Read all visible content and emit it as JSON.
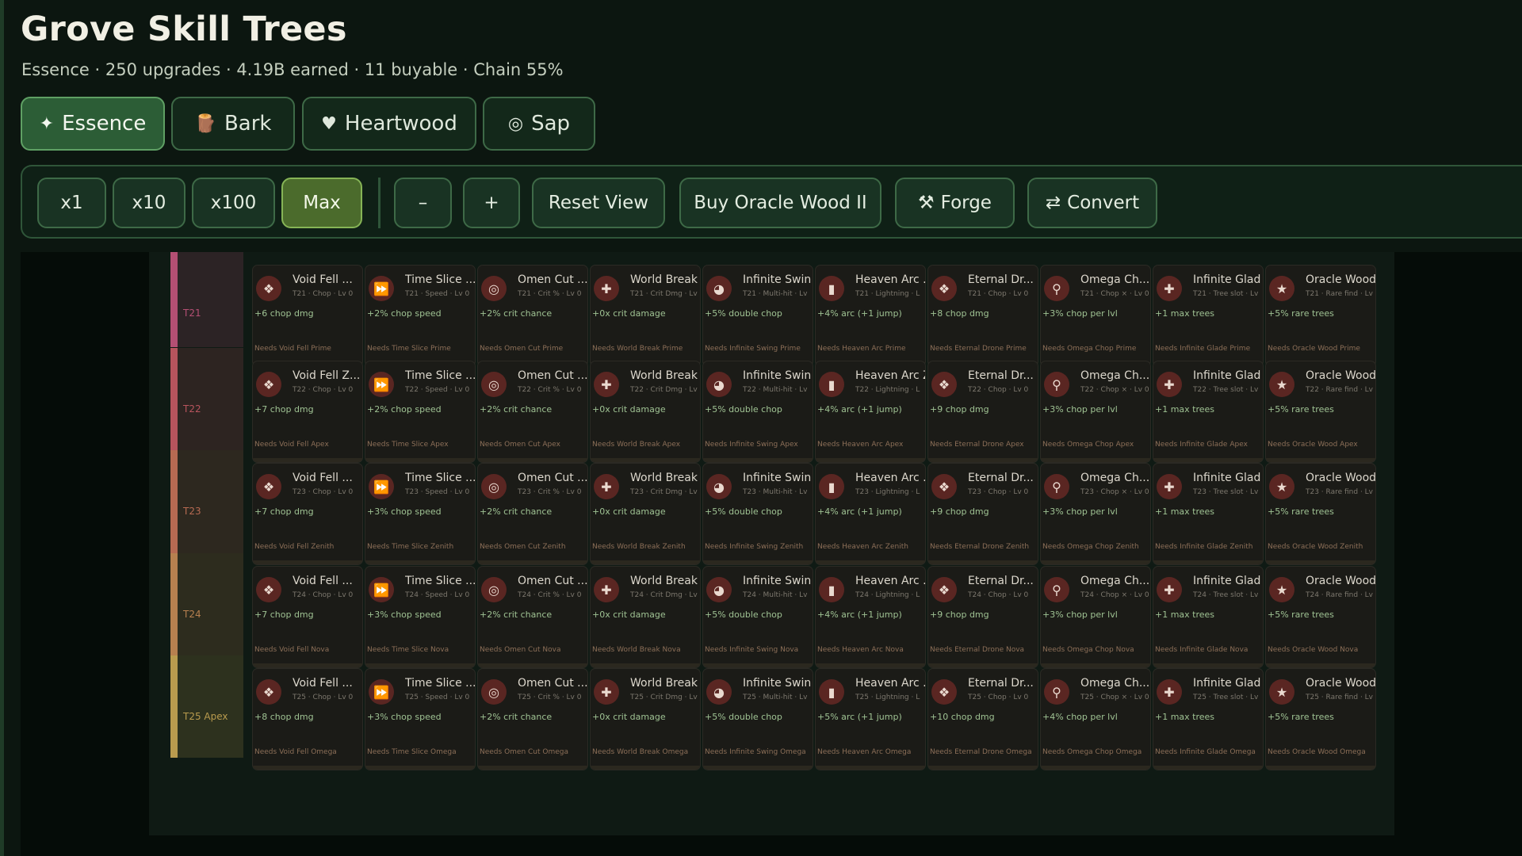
{
  "title": "Grove Skill Trees",
  "subtitle": "Essence · 250 upgrades · 4.19B earned · 11 buyable · Chain 55%",
  "tabs": [
    {
      "label": "Essence",
      "icon": "✦",
      "icon_name": "sparkle-icon"
    },
    {
      "label": "Bark",
      "icon": "🪵",
      "icon_name": "log-icon"
    },
    {
      "label": "Heartwood",
      "icon": "♥",
      "icon_name": "heart-icon"
    },
    {
      "label": "Sap",
      "icon": "◎",
      "icon_name": "target-icon"
    }
  ],
  "toolbar": {
    "x1": "x1",
    "x10": "x10",
    "x100": "x100",
    "max": "Max",
    "minus": "–",
    "plus": "+",
    "reset_view": "Reset View",
    "buy": "Buy Oracle Wood II",
    "forge": "Forge",
    "forge_icon": "⚒",
    "convert": "Convert",
    "convert_icon": "⇄"
  },
  "tiers": [
    {
      "label": "T21",
      "color": "#b44f73"
    },
    {
      "label": "T22",
      "color": "#b7545d"
    },
    {
      "label": "T23",
      "color": "#b76a52"
    },
    {
      "label": "T24",
      "color": "#b7804f"
    },
    {
      "label": "T25 Apex",
      "color": "#b99b4e"
    }
  ],
  "cells": [
    [
      {
        "name": "Void Fell ...",
        "meta": "T21 · Chop · Lv 0",
        "effect": "+6 chop dmg",
        "req": "Needs Void Fell Prime",
        "icon": "❖",
        "icon_name": "leaf-icon"
      },
      {
        "name": "Time Slice ...",
        "meta": "T21 · Speed · Lv 0",
        "effect": "+2% chop speed",
        "req": "Needs Time Slice Prime",
        "icon": "⏩",
        "icon_name": "fast-forward-icon"
      },
      {
        "name": "Omen Cut ...",
        "meta": "T21 · Crit % · Lv 0",
        "effect": "+2% crit chance",
        "req": "Needs Omen Cut Prime",
        "icon": "◎",
        "icon_name": "target-icon"
      },
      {
        "name": "World Break",
        "meta": "T21 · Crit Dmg · Lv",
        "effect": "+0x crit damage",
        "req": "Needs World Break Prime",
        "icon": "✚",
        "icon_name": "plus-icon"
      },
      {
        "name": "Infinite Swin",
        "meta": "T21 · Multi-hit · Lv",
        "effect": "+5% double chop",
        "req": "Needs Infinite Swing Prime",
        "icon": "◕",
        "icon_name": "swing-icon"
      },
      {
        "name": "Heaven Arc ...",
        "meta": "T21 · Lightning · L",
        "effect": "+4% arc (+1 jump)",
        "req": "Needs Heaven Arc Prime",
        "icon": "▮",
        "icon_name": "bar-chart-icon"
      },
      {
        "name": "Eternal Dr...",
        "meta": "T21 · Chop · Lv 0",
        "effect": "+8 chop dmg",
        "req": "Needs Eternal Drone Prime",
        "icon": "❖",
        "icon_name": "leaf-icon"
      },
      {
        "name": "Omega Ch...",
        "meta": "T21 · Chop × · Lv 0",
        "effect": "+3% chop per lvl",
        "req": "Needs Omega Chop Prime",
        "icon": "⚲",
        "icon_name": "magnifier-icon"
      },
      {
        "name": "Infinite Glad",
        "meta": "T21 · Tree slot · Lv",
        "effect": "+1 max trees",
        "req": "Needs Infinite Glade Prime",
        "icon": "✚",
        "icon_name": "plus-icon"
      },
      {
        "name": "Oracle Wood...",
        "meta": "T21 · Rare find · Lv 0",
        "effect": "+5% rare trees",
        "req": "Needs Oracle Wood Prime",
        "icon": "★",
        "icon_name": "star-icon"
      }
    ],
    [
      {
        "name": "Void Fell Z...",
        "meta": "T22 · Chop · Lv 0",
        "effect": "+7 chop dmg",
        "req": "Needs Void Fell Apex",
        "icon": "❖",
        "icon_name": "leaf-icon"
      },
      {
        "name": "Time Slice ...",
        "meta": "T22 · Speed · Lv 0",
        "effect": "+2% chop speed",
        "req": "Needs Time Slice Apex",
        "icon": "⏩",
        "icon_name": "fast-forward-icon"
      },
      {
        "name": "Omen Cut ...",
        "meta": "T22 · Crit % · Lv 0",
        "effect": "+2% crit chance",
        "req": "Needs Omen Cut Apex",
        "icon": "◎",
        "icon_name": "target-icon"
      },
      {
        "name": "World Break",
        "meta": "T22 · Crit Dmg · Lv",
        "effect": "+0x crit damage",
        "req": "Needs World Break Apex",
        "icon": "✚",
        "icon_name": "plus-icon"
      },
      {
        "name": "Infinite Swin",
        "meta": "T22 · Multi-hit · Lv",
        "effect": "+5% double chop",
        "req": "Needs Infinite Swing Apex",
        "icon": "◕",
        "icon_name": "swing-icon"
      },
      {
        "name": "Heaven Arc Z",
        "meta": "T22 · Lightning · L",
        "effect": "+4% arc (+1 jump)",
        "req": "Needs Heaven Arc Apex",
        "icon": "▮",
        "icon_name": "bar-chart-icon"
      },
      {
        "name": "Eternal Dr...",
        "meta": "T22 · Chop · Lv 0",
        "effect": "+9 chop dmg",
        "req": "Needs Eternal Drone Apex",
        "icon": "❖",
        "icon_name": "leaf-icon"
      },
      {
        "name": "Omega Ch...",
        "meta": "T22 · Chop × · Lv 0",
        "effect": "+3% chop per lvl",
        "req": "Needs Omega Chop Apex",
        "icon": "⚲",
        "icon_name": "magnifier-icon"
      },
      {
        "name": "Infinite Glad",
        "meta": "T22 · Tree slot · Lv",
        "effect": "+1 max trees",
        "req": "Needs Infinite Glade Apex",
        "icon": "✚",
        "icon_name": "plus-icon"
      },
      {
        "name": "Oracle Wood...",
        "meta": "T22 · Rare find · Lv 0",
        "effect": "+5% rare trees",
        "req": "Needs Oracle Wood Apex",
        "icon": "★",
        "icon_name": "star-icon"
      }
    ],
    [
      {
        "name": "Void Fell ...",
        "meta": "T23 · Chop · Lv 0",
        "effect": "+7 chop dmg",
        "req": "Needs Void Fell Zenith",
        "icon": "❖",
        "icon_name": "leaf-icon"
      },
      {
        "name": "Time Slice ...",
        "meta": "T23 · Speed · Lv 0",
        "effect": "+3% chop speed",
        "req": "Needs Time Slice Zenith",
        "icon": "⏩",
        "icon_name": "fast-forward-icon"
      },
      {
        "name": "Omen Cut ...",
        "meta": "T23 · Crit % · Lv 0",
        "effect": "+2% crit chance",
        "req": "Needs Omen Cut Zenith",
        "icon": "◎",
        "icon_name": "target-icon"
      },
      {
        "name": "World Break",
        "meta": "T23 · Crit Dmg · Lv",
        "effect": "+0x crit damage",
        "req": "Needs World Break Zenith",
        "icon": "✚",
        "icon_name": "plus-icon"
      },
      {
        "name": "Infinite Swin",
        "meta": "T23 · Multi-hit · Lv",
        "effect": "+5% double chop",
        "req": "Needs Infinite Swing Zenith",
        "icon": "◕",
        "icon_name": "swing-icon"
      },
      {
        "name": "Heaven Arc ...",
        "meta": "T23 · Lightning · L",
        "effect": "+4% arc (+1 jump)",
        "req": "Needs Heaven Arc Zenith",
        "icon": "▮",
        "icon_name": "bar-chart-icon"
      },
      {
        "name": "Eternal Dr...",
        "meta": "T23 · Chop · Lv 0",
        "effect": "+9 chop dmg",
        "req": "Needs Eternal Drone Zenith",
        "icon": "❖",
        "icon_name": "leaf-icon"
      },
      {
        "name": "Omega Ch...",
        "meta": "T23 · Chop × · Lv 0",
        "effect": "+3% chop per lvl",
        "req": "Needs Omega Chop Zenith",
        "icon": "⚲",
        "icon_name": "magnifier-icon"
      },
      {
        "name": "Infinite Glad",
        "meta": "T23 · Tree slot · Lv",
        "effect": "+1 max trees",
        "req": "Needs Infinite Glade Zenith",
        "icon": "✚",
        "icon_name": "plus-icon"
      },
      {
        "name": "Oracle Wood...",
        "meta": "T23 · Rare find · Lv 0",
        "effect": "+5% rare trees",
        "req": "Needs Oracle Wood Zenith",
        "icon": "★",
        "icon_name": "star-icon"
      }
    ],
    [
      {
        "name": "Void Fell ...",
        "meta": "T24 · Chop · Lv 0",
        "effect": "+7 chop dmg",
        "req": "Needs Void Fell Nova",
        "icon": "❖",
        "icon_name": "leaf-icon"
      },
      {
        "name": "Time Slice ...",
        "meta": "T24 · Speed · Lv 0",
        "effect": "+3% chop speed",
        "req": "Needs Time Slice Nova",
        "icon": "⏩",
        "icon_name": "fast-forward-icon"
      },
      {
        "name": "Omen Cut ...",
        "meta": "T24 · Crit % · Lv 0",
        "effect": "+2% crit chance",
        "req": "Needs Omen Cut Nova",
        "icon": "◎",
        "icon_name": "target-icon"
      },
      {
        "name": "World Break",
        "meta": "T24 · Crit Dmg · Lv",
        "effect": "+0x crit damage",
        "req": "Needs World Break Nova",
        "icon": "✚",
        "icon_name": "plus-icon"
      },
      {
        "name": "Infinite Swin",
        "meta": "T24 · Multi-hit · Lv",
        "effect": "+5% double chop",
        "req": "Needs Infinite Swing Nova",
        "icon": "◕",
        "icon_name": "swing-icon"
      },
      {
        "name": "Heaven Arc ...",
        "meta": "T24 · Lightning · L",
        "effect": "+4% arc (+1 jump)",
        "req": "Needs Heaven Arc Nova",
        "icon": "▮",
        "icon_name": "bar-chart-icon"
      },
      {
        "name": "Eternal Dr...",
        "meta": "T24 · Chop · Lv 0",
        "effect": "+9 chop dmg",
        "req": "Needs Eternal Drone Nova",
        "icon": "❖",
        "icon_name": "leaf-icon"
      },
      {
        "name": "Omega Ch...",
        "meta": "T24 · Chop × · Lv 0",
        "effect": "+3% chop per lvl",
        "req": "Needs Omega Chop Nova",
        "icon": "⚲",
        "icon_name": "magnifier-icon"
      },
      {
        "name": "Infinite Glad",
        "meta": "T24 · Tree slot · Lv",
        "effect": "+1 max trees",
        "req": "Needs Infinite Glade Nova",
        "icon": "✚",
        "icon_name": "plus-icon"
      },
      {
        "name": "Oracle Wood...",
        "meta": "T24 · Rare find · Lv 0",
        "effect": "+5% rare trees",
        "req": "Needs Oracle Wood Nova",
        "icon": "★",
        "icon_name": "star-icon"
      }
    ],
    [
      {
        "name": "Void Fell ...",
        "meta": "T25 · Chop · Lv 0",
        "effect": "+8 chop dmg",
        "req": "Needs Void Fell Omega",
        "icon": "❖",
        "icon_name": "leaf-icon"
      },
      {
        "name": "Time Slice ...",
        "meta": "T25 · Speed · Lv 0",
        "effect": "+3% chop speed",
        "req": "Needs Time Slice Omega",
        "icon": "⏩",
        "icon_name": "fast-forward-icon"
      },
      {
        "name": "Omen Cut ...",
        "meta": "T25 · Crit % · Lv 0",
        "effect": "+2% crit chance",
        "req": "Needs Omen Cut Omega",
        "icon": "◎",
        "icon_name": "target-icon"
      },
      {
        "name": "World Break",
        "meta": "T25 · Crit Dmg · Lv",
        "effect": "+0x crit damage",
        "req": "Needs World Break Omega",
        "icon": "✚",
        "icon_name": "plus-icon"
      },
      {
        "name": "Infinite Swin",
        "meta": "T25 · Multi-hit · Lv",
        "effect": "+5% double chop",
        "req": "Needs Infinite Swing Omega",
        "icon": "◕",
        "icon_name": "swing-icon"
      },
      {
        "name": "Heaven Arc ...",
        "meta": "T25 · Lightning · L",
        "effect": "+5% arc (+1 jump)",
        "req": "Needs Heaven Arc Omega",
        "icon": "▮",
        "icon_name": "bar-chart-icon"
      },
      {
        "name": "Eternal Dr...",
        "meta": "T25 · Chop · Lv 0",
        "effect": "+10 chop dmg",
        "req": "Needs Eternal Drone Omega",
        "icon": "❖",
        "icon_name": "leaf-icon"
      },
      {
        "name": "Omega Ch...",
        "meta": "T25 · Chop × · Lv 0",
        "effect": "+4% chop per lvl",
        "req": "Needs Omega Chop Omega",
        "icon": "⚲",
        "icon_name": "magnifier-icon"
      },
      {
        "name": "Infinite Glad",
        "meta": "T25 · Tree slot · Lv",
        "effect": "+1 max trees",
        "req": "Needs Infinite Glade Omega",
        "icon": "✚",
        "icon_name": "plus-icon"
      },
      {
        "name": "Oracle Wood...",
        "meta": "T25 · Rare find · Lv 0",
        "effect": "+5% rare trees",
        "req": "Needs Oracle Wood Omega",
        "icon": "★",
        "icon_name": "star-icon"
      }
    ]
  ]
}
